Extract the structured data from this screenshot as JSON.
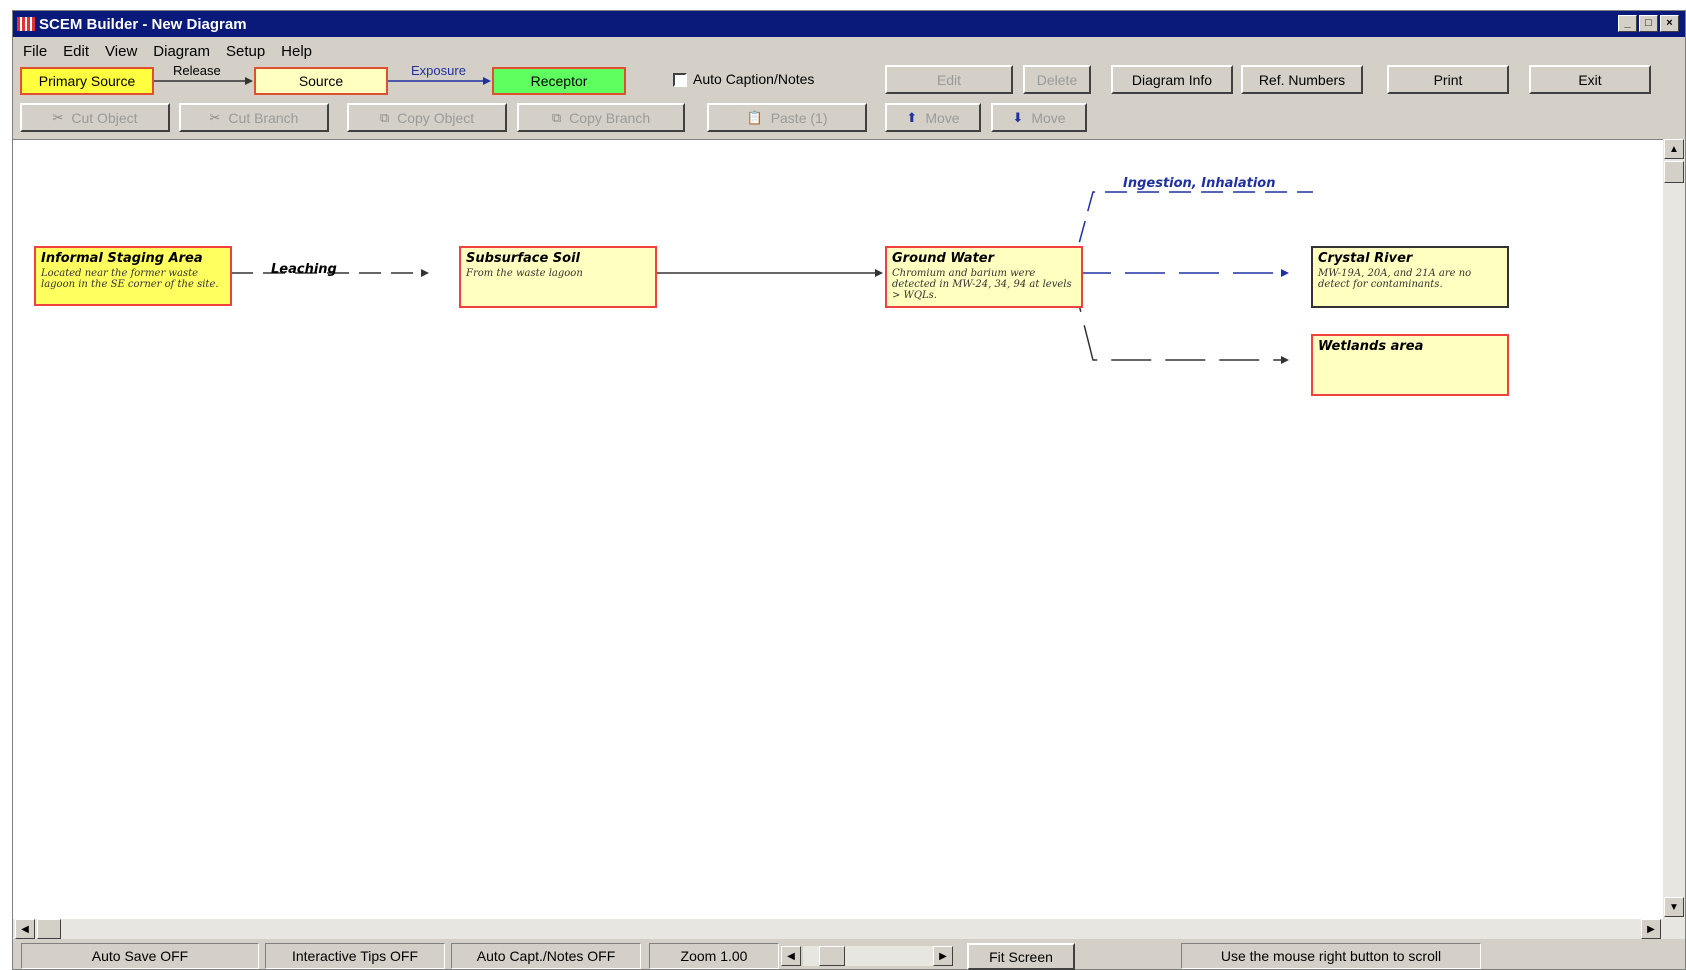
{
  "window": {
    "title": "SCEM Builder - New Diagram",
    "buttons": [
      "_",
      "□",
      "×"
    ]
  },
  "menu": [
    "File",
    "Edit",
    "View",
    "Diagram",
    "Setup",
    "Help"
  ],
  "legend": {
    "primary_source": "Primary Source",
    "release": "Release",
    "source": "Source",
    "exposure": "Exposure",
    "receptor": "Receptor",
    "colors": {
      "primary_source": "#ffff40",
      "source": "#ffffc0",
      "receptor": "#60ff60"
    }
  },
  "toolbar1": {
    "auto_caption_label": "Auto Caption/Notes",
    "auto_caption_checked": false,
    "edit": "Edit",
    "delete": "Delete",
    "diagram_info": "Diagram Info",
    "ref_numbers": "Ref. Numbers",
    "print": "Print",
    "exit": "Exit"
  },
  "toolbar2": {
    "cut_object": "Cut Object",
    "cut_branch": "Cut Branch",
    "copy_object": "Copy Object",
    "copy_branch": "Copy Branch",
    "paste": "Paste (1)",
    "move_up": "Move",
    "move_down": "Move"
  },
  "diagram": {
    "nodes": {
      "staging": {
        "title": "Informal Staging Area",
        "desc": "Located near the former waste lagoon in the SE corner of the site."
      },
      "soil": {
        "title": "Subsurface Soil",
        "desc": "From the waste lagoon"
      },
      "groundwater": {
        "title": "Ground Water",
        "desc": "Chromium and barium were detected in MW-24, 34, 94 at levels > WQLs."
      },
      "river": {
        "title": "Crystal River",
        "desc": "MW-19A, 20A, and 21A are no detect for contaminants."
      },
      "wetlands": {
        "title": "Wetlands area",
        "desc": ""
      }
    },
    "edges": {
      "leaching": "Leaching",
      "ingestion": "Ingestion, Inhalation"
    },
    "colors": {
      "exposure_line": "#2030a0",
      "release_line": "#333333"
    }
  },
  "status": {
    "auto_save": "Auto Save OFF",
    "tips": "Interactive Tips OFF",
    "auto_capt": "Auto Capt./Notes OFF",
    "zoom": "Zoom 1.00",
    "fit_screen": "Fit Screen",
    "hint": "Use the mouse right button to scroll"
  }
}
